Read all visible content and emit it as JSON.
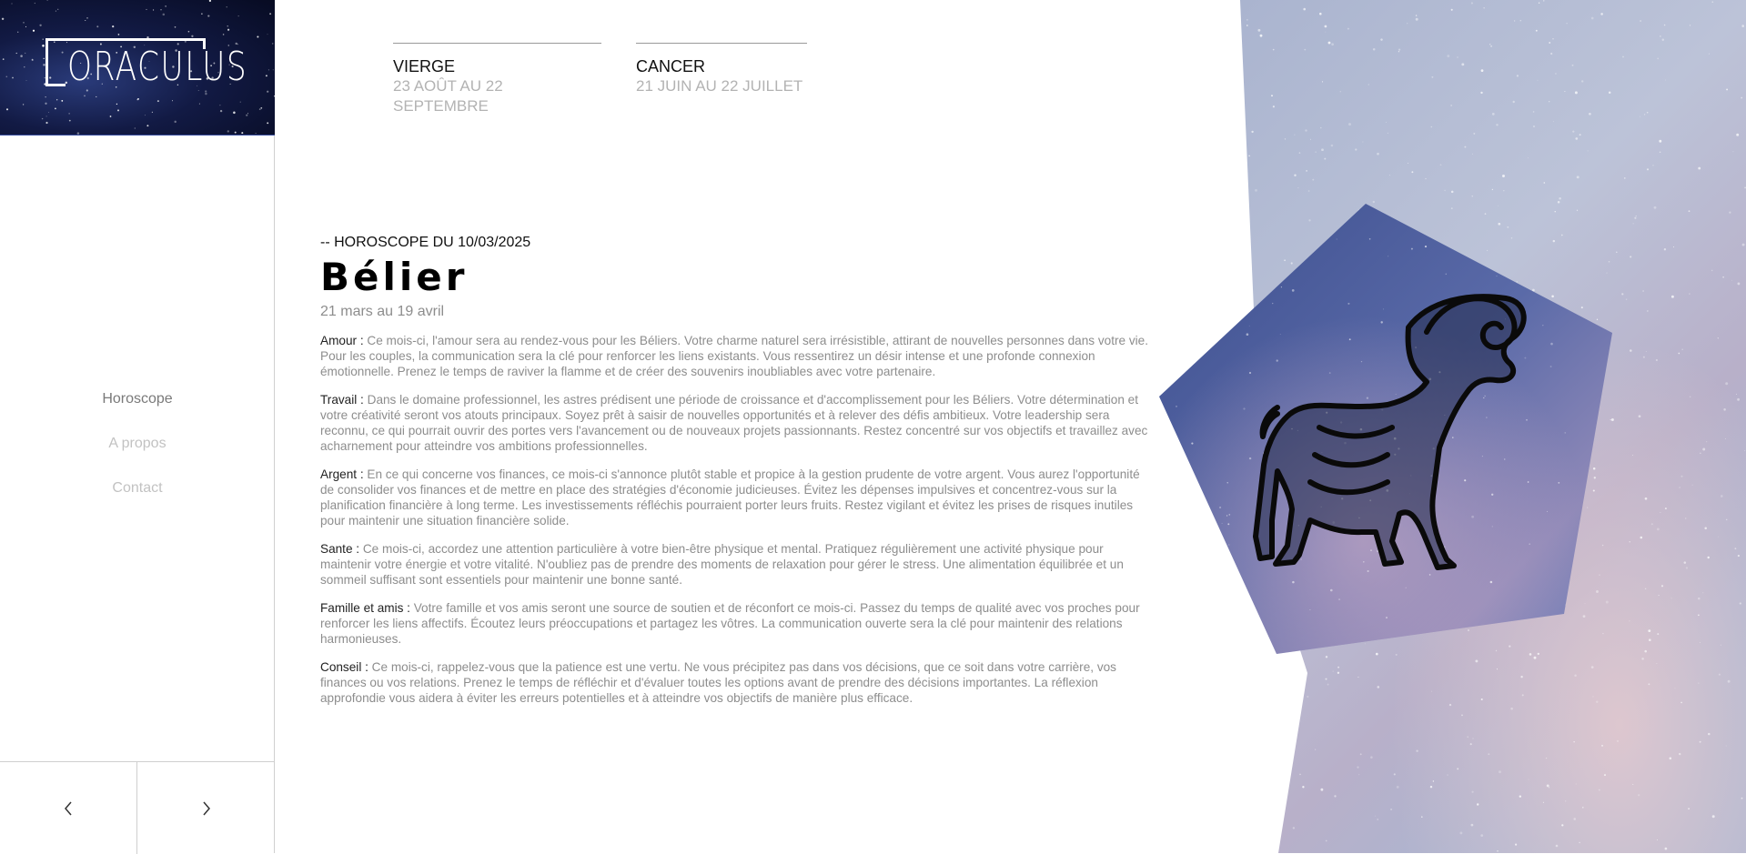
{
  "brand": {
    "logo_text": "ORACULUS"
  },
  "nav": {
    "items": [
      {
        "label": "Horoscope"
      },
      {
        "label": "A propos"
      },
      {
        "label": "Contact"
      }
    ]
  },
  "pager": {
    "prev_icon": "chevron-left-icon",
    "next_icon": "chevron-right-icon"
  },
  "signs": [
    {
      "name": "VIERGE",
      "dates": "23 AOÛT AU 22 SEPTEMBRE"
    },
    {
      "name": "CANCER",
      "dates": "21 JUIN AU 22 JUILLET"
    }
  ],
  "article": {
    "overline": "-- HOROSCOPE DU 10/03/2025",
    "title": "Bélier",
    "subtitle": "21 mars au 19 avril",
    "sections": [
      {
        "label": "Amour :",
        "text": " Ce mois-ci, l'amour sera au rendez-vous pour les Béliers. Votre charme naturel sera irrésistible, attirant de nouvelles personnes dans votre vie. Pour les couples, la communication sera la clé pour renforcer les liens existants. Vous ressentirez un désir intense et une profonde connexion émotionnelle. Prenez le temps de raviver la flamme et de créer des souvenirs inoubliables avec votre partenaire."
      },
      {
        "label": "Travail :",
        "text": " Dans le domaine professionnel, les astres prédisent une période de croissance et d'accomplissement pour les Béliers. Votre détermination et votre créativité seront vos atouts principaux. Soyez prêt à saisir de nouvelles opportunités et à relever des défis ambitieux. Votre leadership sera reconnu, ce qui pourrait ouvrir des portes vers l'avancement ou de nouveaux projets passionnants. Restez concentré sur vos objectifs et travaillez avec acharnement pour atteindre vos ambitions professionnelles."
      },
      {
        "label": "Argent :",
        "text": " En ce qui concerne vos finances, ce mois-ci s'annonce plutôt stable et propice à la gestion prudente de votre argent. Vous aurez l'opportunité de consolider vos finances et de mettre en place des stratégies d'économie judicieuses. Évitez les dépenses impulsives et concentrez-vous sur la planification financière à long terme. Les investissements réfléchis pourraient porter leurs fruits. Restez vigilant et évitez les prises de risques inutiles pour maintenir une situation financière solide."
      },
      {
        "label": "Sante :",
        "text": " Ce mois-ci, accordez une attention particulière à votre bien-être physique et mental. Pratiquez régulièrement une activité physique pour maintenir votre énergie et votre vitalité. N'oubliez pas de prendre des moments de relaxation pour gérer le stress. Une alimentation équilibrée et un sommeil suffisant sont essentiels pour maintenir une bonne santé."
      },
      {
        "label": "Famille et amis :",
        "text": " Votre famille et vos amis seront une source de soutien et de réconfort ce mois-ci. Passez du temps de qualité avec vos proches pour renforcer les liens affectifs. Écoutez leurs préoccupations et partagez les vôtres. La communication ouverte sera la clé pour maintenir des relations harmonieuses."
      },
      {
        "label": "Conseil :",
        "text": " Ce mois-ci, rappelez-vous que la patience est une vertu. Ne vous précipitez pas dans vos décisions, que ce soit dans votre carrière, vos finances ou vos relations. Prenez le temps de réfléchir et d'évaluer toutes les options avant de prendre des décisions importantes. La réflexion approfondie vous aidera à éviter les erreurs potentielles et à atteindre vos objectifs de manière plus efficace."
      }
    ]
  },
  "illustration": {
    "icon": "ram-icon"
  },
  "colors": {
    "sky_light": "#b9c3dc",
    "sky_dark": "#4f5f9e",
    "logo_bg": "#0d1437",
    "text_muted": "#8d8d8d"
  }
}
